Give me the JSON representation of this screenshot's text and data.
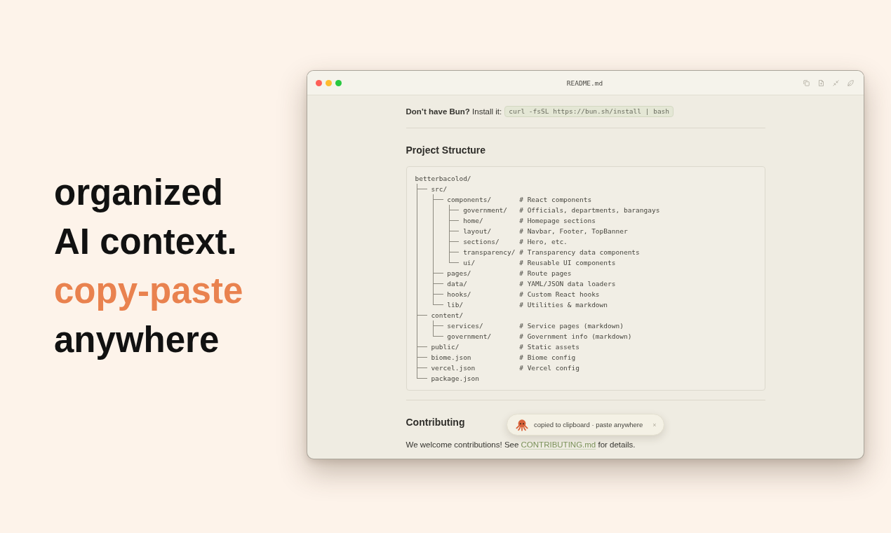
{
  "headline": {
    "lines": [
      {
        "text": "organized",
        "accent": false
      },
      {
        "text": "AI context.",
        "accent": false
      },
      {
        "text": "copy-paste",
        "accent": true
      },
      {
        "text": "anywhere",
        "accent": false
      }
    ]
  },
  "window": {
    "title": "README.md"
  },
  "readme": {
    "install_note": {
      "text": "**Don’t have Bun?** Install it:",
      "command": "curl -fsSL https://bun.sh/install | bash"
    },
    "project_structure": {
      "heading": "Project Structure",
      "tree": {
        "root": "betterbacolod/",
        "children": [
          {
            "name": "src/",
            "children": [
              {
                "name": "components/",
                "comment": "# React components",
                "children": [
                  {
                    "name": "government/",
                    "comment": "# Officials, departments, barangays"
                  },
                  {
                    "name": "home/",
                    "comment": "# Homepage sections"
                  },
                  {
                    "name": "layout/",
                    "comment": "# Navbar, Footer, TopBanner"
                  },
                  {
                    "name": "sections/",
                    "comment": "# Hero, etc."
                  },
                  {
                    "name": "transparency/",
                    "comment": "# Transparency data components"
                  },
                  {
                    "name": "ui/",
                    "comment": "# Reusable UI components"
                  }
                ]
              },
              {
                "name": "pages/",
                "comment": "# Route pages"
              },
              {
                "name": "data/",
                "comment": "# YAML/JSON data loaders"
              },
              {
                "name": "hooks/",
                "comment": "# Custom React hooks"
              },
              {
                "name": "lib/",
                "comment": "# Utilities & markdown"
              }
            ]
          },
          {
            "name": "content/",
            "children": [
              {
                "name": "services/",
                "comment": "# Service pages (markdown)"
              },
              {
                "name": "government/",
                "comment": "# Government info (markdown)"
              }
            ]
          },
          {
            "name": "public/",
            "comment": "# Static assets"
          },
          {
            "name": "biome.json",
            "comment": "# Biome config"
          },
          {
            "name": "vercel.json",
            "comment": "# Vercel config"
          },
          {
            "name": "package.json"
          }
        ]
      }
    },
    "contributing": {
      "heading": "Contributing",
      "text_before": "We welcome contributions! See ",
      "link": "CONTRIBUTING.md",
      "text_after": " for details."
    }
  },
  "toast": {
    "message": "copied to clipboard · paste anywhere",
    "close": "×"
  }
}
